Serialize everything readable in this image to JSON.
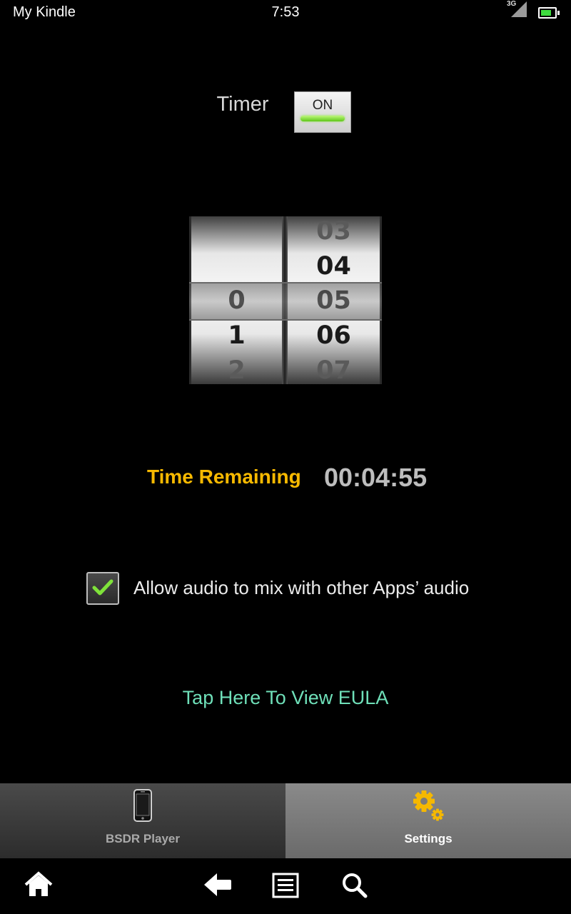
{
  "status_bar": {
    "device_name": "My Kindle",
    "time": "7:53",
    "network": "3G",
    "battery_icon": "battery-icon",
    "signal_icon": "signal-icon"
  },
  "timer": {
    "label": "Timer",
    "toggle_label": "ON",
    "toggle_color": "#7ee03a"
  },
  "picker": {
    "hours": [
      "0",
      "1",
      "2"
    ],
    "minutes": [
      "03",
      "04",
      "05",
      "06",
      "07"
    ],
    "selected_hour": "0",
    "selected_minute": "05"
  },
  "time_remaining": {
    "label": "Time Remaining",
    "value": "00:04:55",
    "label_color": "#f7b900"
  },
  "mix_audio": {
    "label": "Allow audio to mix with other Apps’ audio",
    "checked": true,
    "check_color": "#7fe23a"
  },
  "eula": {
    "label": "Tap Here To View EULA",
    "color": "#6fe0b9"
  },
  "tabs": [
    {
      "label": "BSDR Player",
      "icon": "phone-icon",
      "selected": false
    },
    {
      "label": "Settings",
      "icon": "gears-icon",
      "selected": true
    }
  ],
  "nav": {
    "icons": [
      "home-icon",
      "back-icon",
      "menu-icon",
      "search-icon"
    ]
  }
}
